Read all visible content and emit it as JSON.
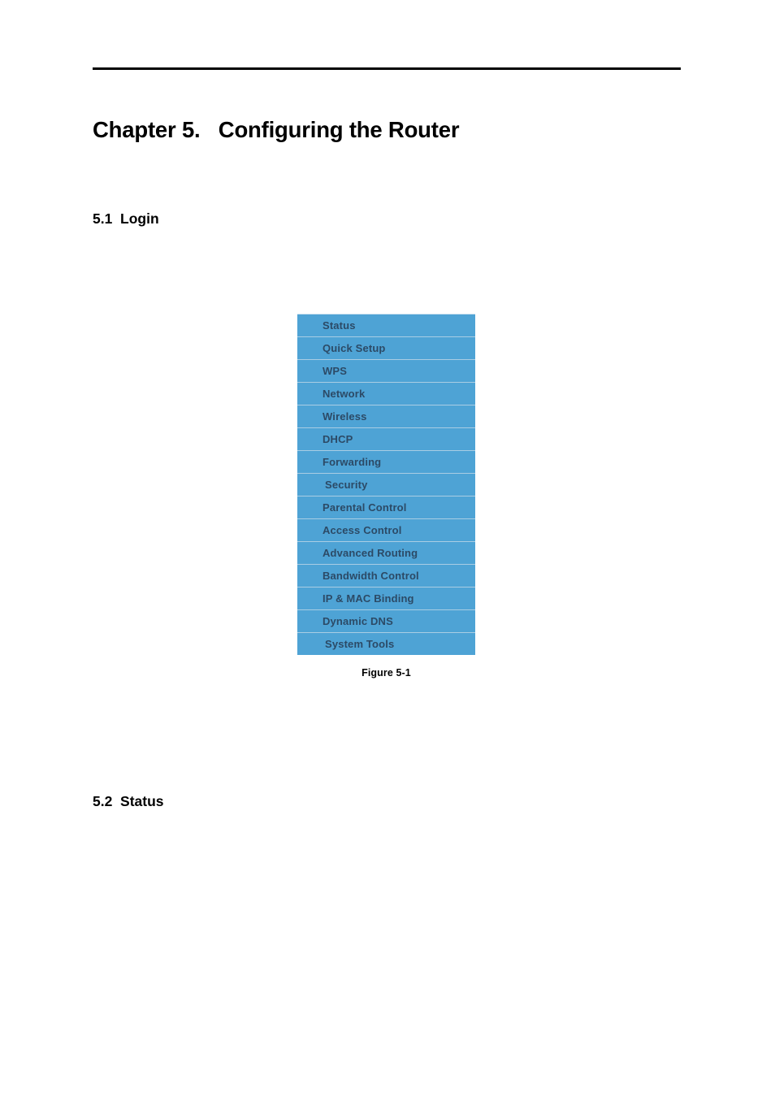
{
  "document": {
    "chapter_title": "Chapter 5.   Configuring the Router",
    "sections": [
      {
        "number": "5.1",
        "title": "Login",
        "label": "5.1  Login"
      },
      {
        "number": "5.2",
        "title": "Status",
        "label": "5.2  Status"
      }
    ]
  },
  "figure": {
    "caption": "Figure 5-1",
    "menu_background_color": "#4ea3d5",
    "menu_text_color": "#2c4a66",
    "menu_separator_color": "#a9cde4",
    "items": [
      {
        "label": "Status"
      },
      {
        "label": "Quick Setup"
      },
      {
        "label": "WPS"
      },
      {
        "label": "Network"
      },
      {
        "label": "Wireless"
      },
      {
        "label": "DHCP"
      },
      {
        "label": "Forwarding"
      },
      {
        "label": "Security"
      },
      {
        "label": "Parental Control"
      },
      {
        "label": "Access Control"
      },
      {
        "label": "Advanced Routing"
      },
      {
        "label": "Bandwidth Control"
      },
      {
        "label": "IP & MAC Binding"
      },
      {
        "label": "Dynamic DNS"
      },
      {
        "label": "System Tools"
      }
    ]
  }
}
